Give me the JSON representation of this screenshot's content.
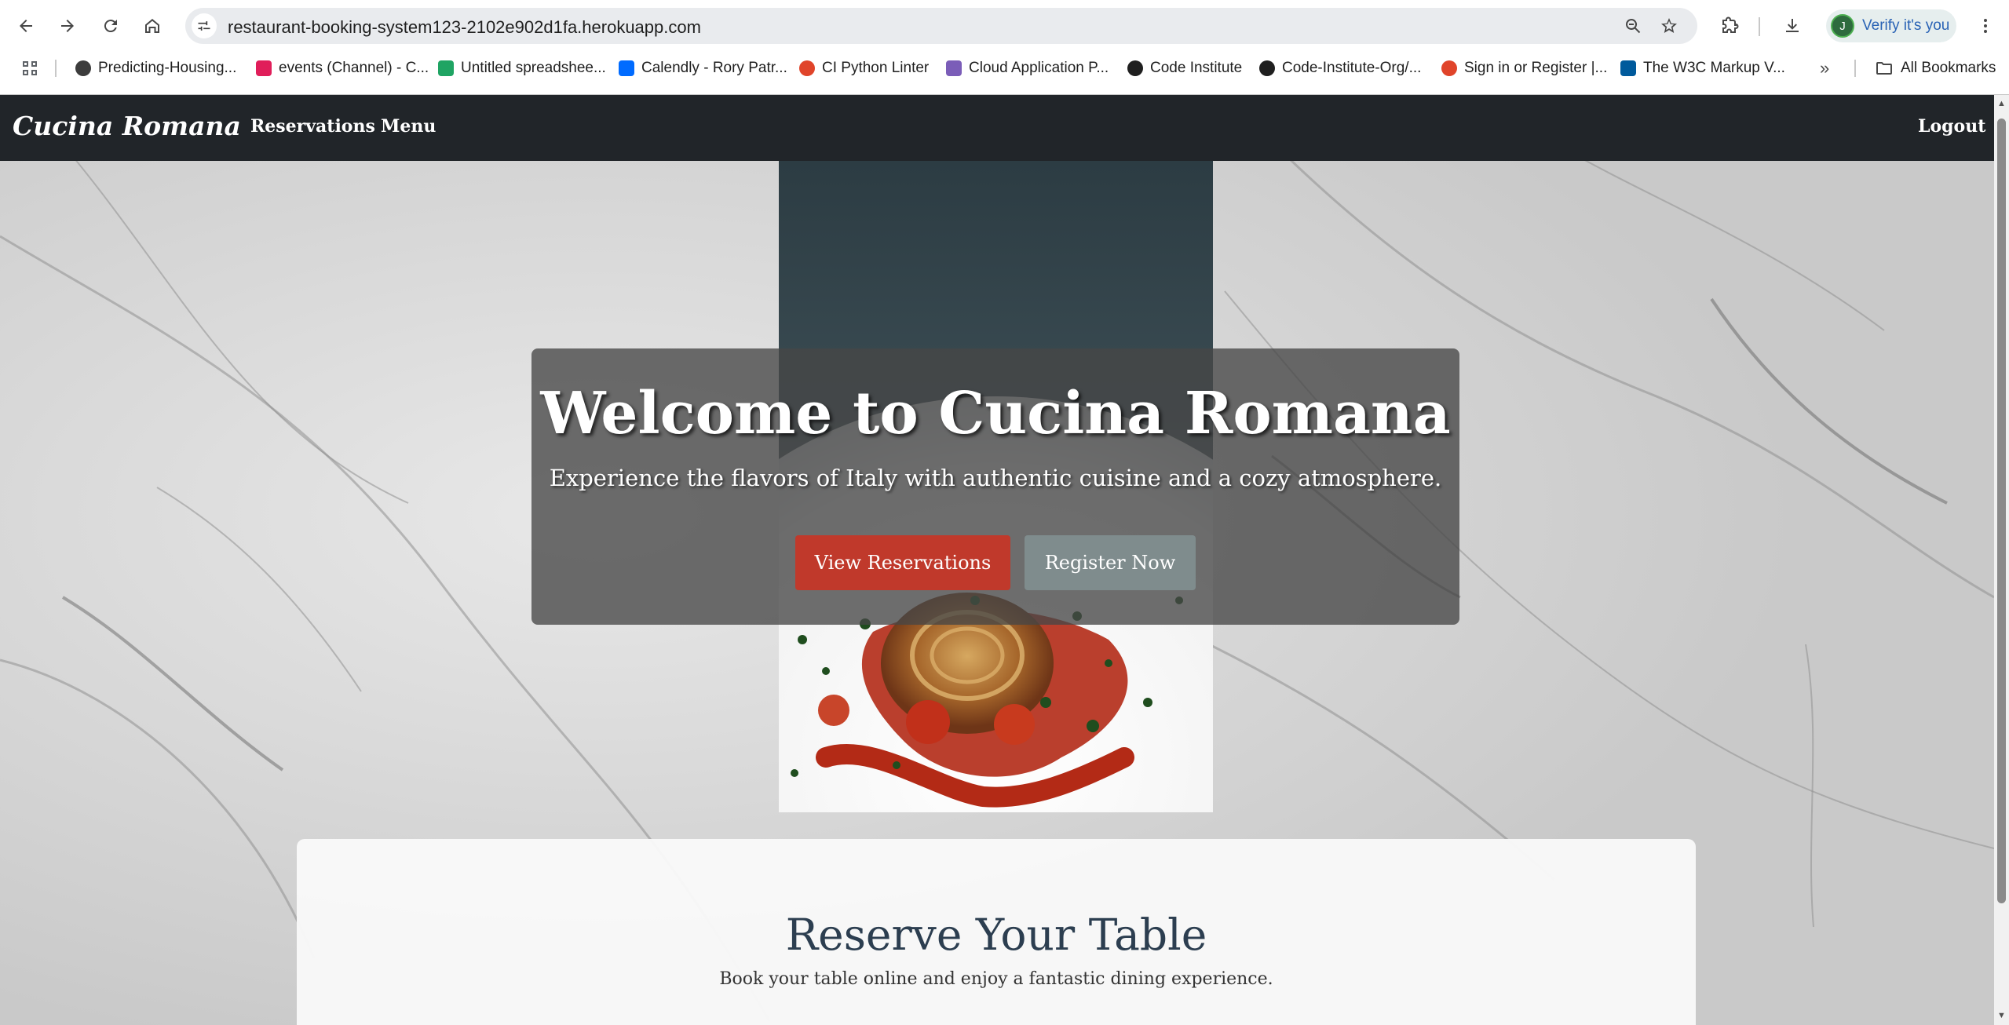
{
  "browser": {
    "url": "restaurant-booking-system123-2102e902d1fa.herokuapp.com",
    "verify_label": "Verify it's you",
    "avatar_letter": "J",
    "bookmarks": [
      {
        "label": "Predicting-Housing...",
        "icon": "globe-icon",
        "color": "#3c3c3c"
      },
      {
        "label": "events (Channel) - C...",
        "icon": "slack-icon",
        "color": "#e01e5a"
      },
      {
        "label": "Untitled spreadshee...",
        "icon": "drive-icon",
        "color": "#1fa463"
      },
      {
        "label": "Calendly - Rory Patr...",
        "icon": "calendly-icon",
        "color": "#006bff"
      },
      {
        "label": "CI Python Linter",
        "icon": "ci-icon",
        "color": "#e0442a"
      },
      {
        "label": "Cloud Application P...",
        "icon": "heroku-icon",
        "color": "#7b5db8"
      },
      {
        "label": "Code Institute",
        "icon": "github-icon",
        "color": "#1f1f1f"
      },
      {
        "label": "Code-Institute-Org/...",
        "icon": "github-icon",
        "color": "#1f1f1f"
      },
      {
        "label": "Sign in or Register |...",
        "icon": "ci-icon",
        "color": "#e0442a"
      },
      {
        "label": "The W3C Markup V...",
        "icon": "w3c-icon",
        "color": "#005a9c"
      }
    ],
    "all_bookmarks_label": "All Bookmarks"
  },
  "navbar": {
    "brand": "Cucina Romana",
    "links": [
      "Reservations",
      "Menu"
    ],
    "logout": "Logout"
  },
  "hero": {
    "title": "Welcome to Cucina Romana",
    "subtitle": "Experience the flavors of Italy with authentic cuisine and a cozy atmosphere.",
    "primary_button": "View Reservations",
    "secondary_button": "Register Now"
  },
  "reserve": {
    "title": "Reserve Your Table",
    "subtitle": "Book your table online and enjoy a fantastic dining experience."
  },
  "colors": {
    "navbar_bg": "#212529",
    "primary_button": "#c0392b",
    "secondary_button": "#7f8c8d",
    "heading": "#2c3e50"
  }
}
